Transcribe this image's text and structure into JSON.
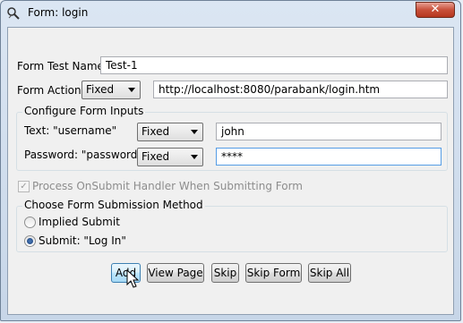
{
  "window": {
    "title": "Form: login",
    "close_label": "✕"
  },
  "form": {
    "test_name_label": "Form Test Name",
    "test_name_value": "Test-1",
    "action_label": "Form Action",
    "action_mode": "Fixed",
    "action_value": "http://localhost:8080/parabank/login.htm"
  },
  "inputs_group": {
    "title": "Configure Form Inputs",
    "rows": [
      {
        "label": "Text: \"username\"",
        "mode": "Fixed",
        "value": "john"
      },
      {
        "label": "Password: \"password\"",
        "mode": "Fixed",
        "value": "****"
      }
    ]
  },
  "onsubmit": {
    "label": "Process OnSubmit Handler When Submitting Form",
    "checked": true,
    "enabled": false
  },
  "submission_group": {
    "title": "Choose Form Submission Method",
    "options": [
      {
        "label": "Implied Submit",
        "selected": false
      },
      {
        "label": "Submit: \"Log In\"",
        "selected": true
      }
    ]
  },
  "buttons": {
    "add": "Add",
    "view_page": "View Page",
    "skip": "Skip",
    "skip_form": "Skip Form",
    "skip_all": "Skip All"
  }
}
